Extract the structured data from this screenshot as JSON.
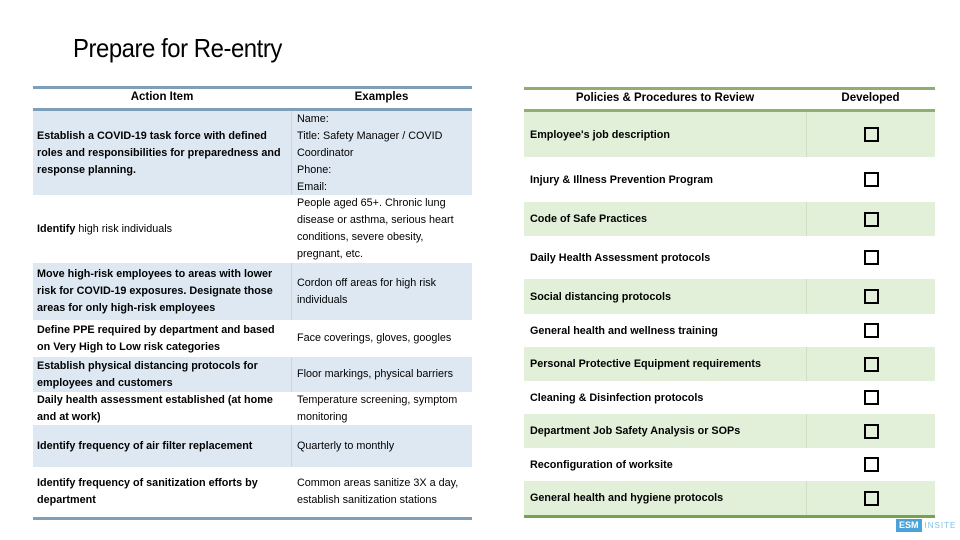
{
  "title": "Prepare for Re-entry",
  "action_table": {
    "headers": {
      "action": "Action Item",
      "examples": "Examples"
    },
    "rows": [
      {
        "action_bold": "Establish a COVID-19 task force with defined roles and responsibilities for preparedness and response planning.",
        "action_rest": "",
        "examples": "Name:\nTitle: Safety Manager / COVID Coordinator\nPhone:\nEmail:"
      },
      {
        "action_bold": "Identify",
        "action_rest": " high risk individuals",
        "examples": "People aged 65+. Chronic lung disease or asthma, serious heart conditions, severe obesity, pregnant, etc."
      },
      {
        "action_bold": "Move high-risk employees to areas with lower risk for COVID-19 exposures. Designate those areas for only high-risk employees",
        "action_rest": "",
        "examples": "Cordon off areas for high risk individuals"
      },
      {
        "action_bold": "Define PPE required by department and based on Very High to Low risk categories",
        "action_rest": "",
        "examples": "Face coverings, gloves, googles"
      },
      {
        "action_bold": "Establish physical distancing protocols for employees and customers",
        "action_rest": "",
        "examples": "Floor markings, physical barriers"
      },
      {
        "action_bold": "Daily health assessment established (at home and at work)",
        "action_rest": "",
        "examples": "Temperature screening, symptom monitoring"
      },
      {
        "action_bold": "Identify frequency of air filter replacement",
        "action_rest": "",
        "examples": "Quarterly to monthly"
      },
      {
        "action_bold": "Identify frequency of sanitization efforts by department",
        "action_rest": "",
        "examples": "Common areas sanitize 3X a day, establish sanitization stations"
      }
    ]
  },
  "policy_table": {
    "headers": {
      "policy": "Policies & Procedures to Review",
      "developed": "Developed"
    },
    "rows": [
      {
        "policy": "Employee's job description",
        "developed": false
      },
      {
        "policy": "Injury & Illness Prevention Program",
        "developed": false
      },
      {
        "policy": "Code of Safe Practices",
        "developed": false
      },
      {
        "policy": "Daily Health Assessment protocols",
        "developed": false
      },
      {
        "policy": "Social distancing protocols",
        "developed": false
      },
      {
        "policy": "General health and wellness training",
        "developed": false
      },
      {
        "policy": "Personal Protective Equipment requirements",
        "developed": false
      },
      {
        "policy": "Cleaning & Disinfection protocols",
        "developed": false
      },
      {
        "policy": "Department Job Safety Analysis or SOPs",
        "developed": false
      },
      {
        "policy": "Reconfiguration of worksite",
        "developed": false
      },
      {
        "policy": "General health and hygiene protocols",
        "developed": false
      }
    ]
  },
  "logo": {
    "primary": "ESM",
    "secondary": "INSITE"
  },
  "colors": {
    "left_header_rule": "#7f9fb8",
    "left_band": "#dde8f3",
    "right_header_rule": "#8fae6f",
    "right_band": "#e2efd9",
    "logo_blue": "#4aa3d8"
  }
}
